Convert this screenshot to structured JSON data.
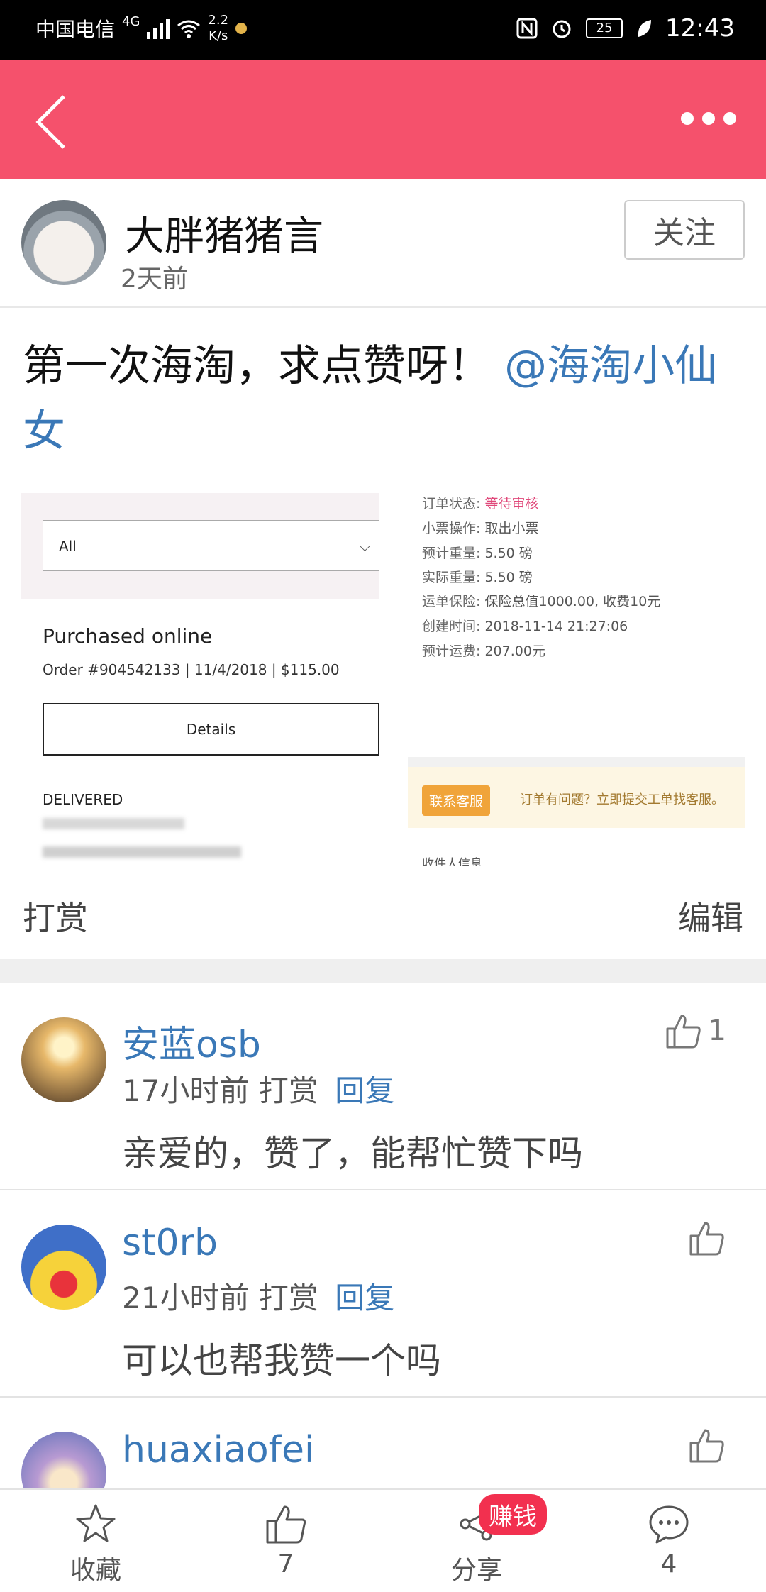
{
  "status_bar": {
    "carrier": "中国电信",
    "network": "4G",
    "speed_value": "2.2",
    "speed_unit": "K/s",
    "battery": "25",
    "time": "12:43"
  },
  "header": {
    "back_icon": "chevron-left-icon",
    "more_icon": "more-horizontal-icon"
  },
  "author": {
    "name": "大胖猪猪言",
    "time": "2天前",
    "follow_label": "关注"
  },
  "post": {
    "text": "第一次海淘，求点赞呀！",
    "mention": "@海淘小仙女",
    "image": {
      "left": {
        "select_value": "All",
        "title": "Purchased online",
        "order_line": "Order #904542133 | 11/4/2018 | $115.00",
        "details_label": "Details",
        "status": "DELIVERED"
      },
      "right": {
        "rows": [
          {
            "label": "订单状态:",
            "value": "等待审核"
          },
          {
            "label": "小票操作:",
            "value": "取出小票"
          },
          {
            "label": "预计重量:",
            "value": "5.50 磅"
          },
          {
            "label": "实际重量:",
            "value": "5.50 磅"
          },
          {
            "label": "运单保险:",
            "value": "保险总值1000.00, 收费10元"
          },
          {
            "label": "创建时间:",
            "value": "2018-11-14 21:27:06"
          },
          {
            "label": "预计运费:",
            "value": "207.00元"
          }
        ],
        "contact_label": "联系客服",
        "contact_tip": "订单有问题？立即提交工单找客服。",
        "receiver_label": "收件人信息"
      }
    },
    "reward_label": "打赏",
    "edit_label": "编辑"
  },
  "comments": [
    {
      "name": "安蓝osb",
      "time": "17小时前",
      "reward": "打赏",
      "reply": "回复",
      "text": "亲爱的，赞了，能帮忙赞下吗",
      "likes": "1"
    },
    {
      "name": "st0rb",
      "time": "21小时前",
      "reward": "打赏",
      "reply": "回复",
      "text": "可以也帮我赞一个吗",
      "likes": ""
    },
    {
      "name": "huaxiaofei",
      "time": "",
      "reward": "",
      "reply": "",
      "text": "",
      "likes": ""
    }
  ],
  "bottom_nav": {
    "favorite": "收藏",
    "like_count": "7",
    "share": "分享",
    "earn_badge": "赚钱",
    "comment_count": "4"
  },
  "colors": {
    "header": "#f5516c",
    "link": "#3a78b7",
    "badge": "#f2304f"
  }
}
